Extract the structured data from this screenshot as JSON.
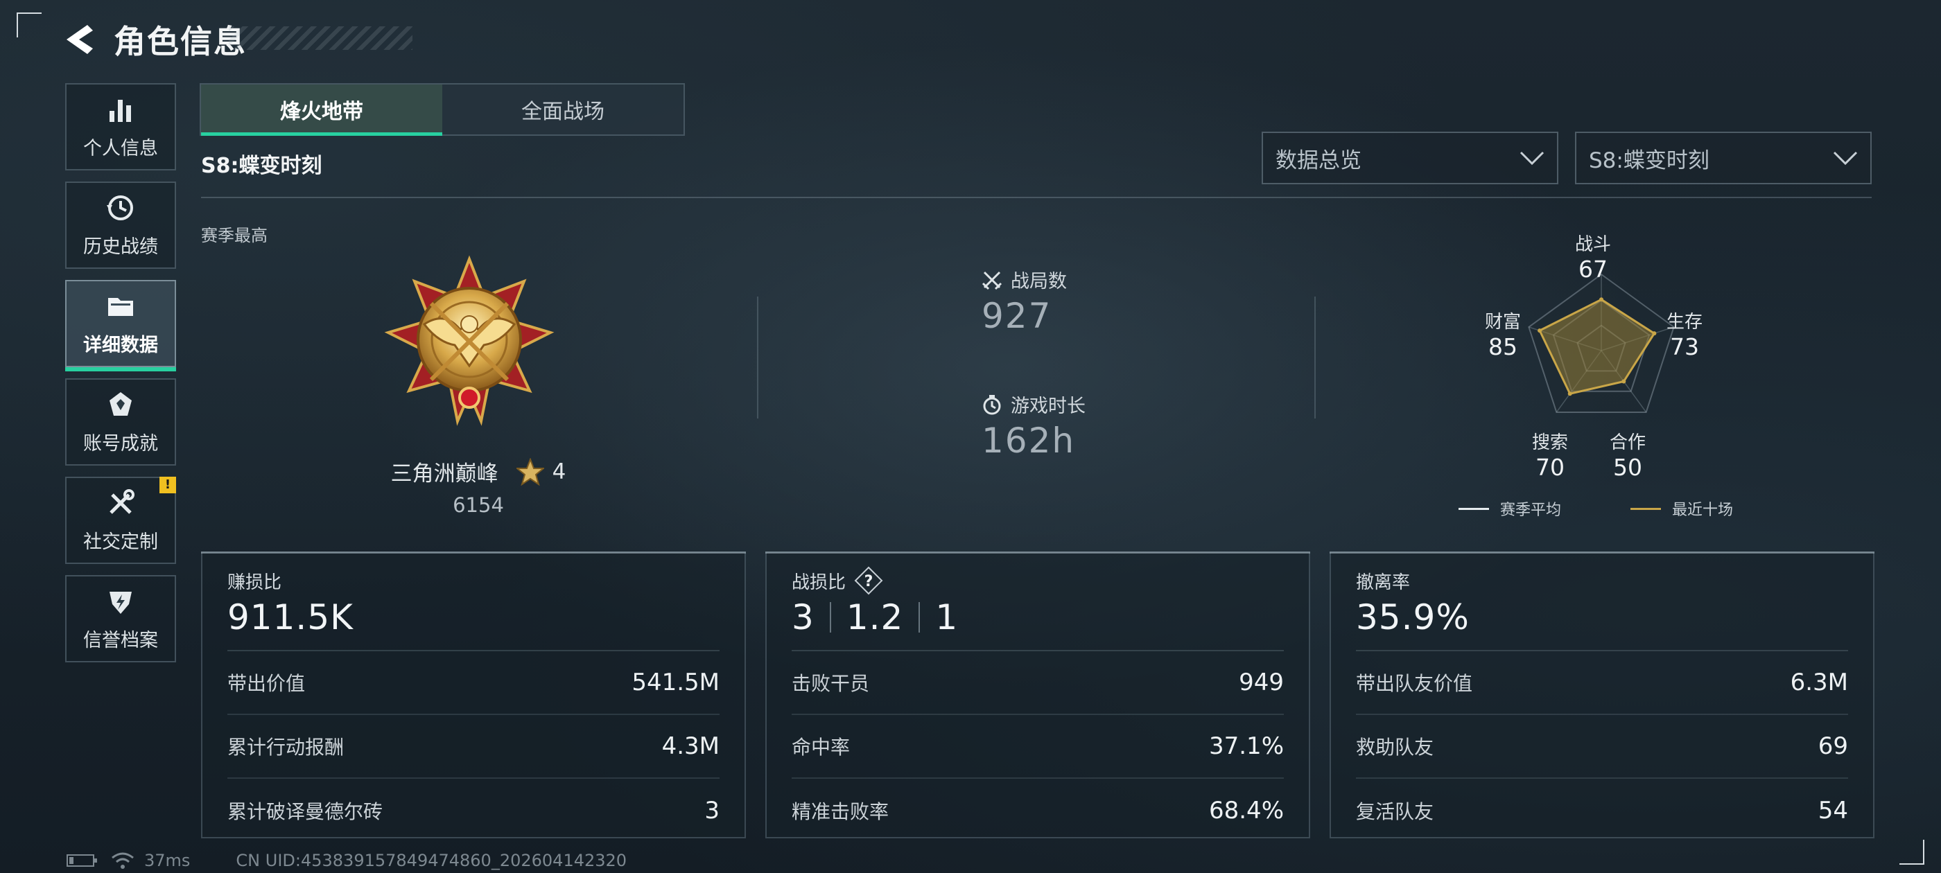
{
  "header": {
    "title": "角色信息"
  },
  "sidebar": {
    "items": [
      {
        "label": "个人信息",
        "icon": "bar-chart-icon",
        "active": false
      },
      {
        "label": "历史战绩",
        "icon": "history-icon",
        "active": false
      },
      {
        "label": "详细数据",
        "icon": "folder-icon",
        "active": true
      },
      {
        "label": "账号成就",
        "icon": "achievement-icon",
        "active": false
      },
      {
        "label": "社交定制",
        "icon": "tools-icon",
        "active": false,
        "badge": "!"
      },
      {
        "label": "信誉档案",
        "icon": "reputation-icon",
        "active": false
      }
    ]
  },
  "tabs": [
    {
      "label": "烽火地带",
      "active": true
    },
    {
      "label": "全面战场",
      "active": false
    }
  ],
  "season": {
    "label": "S8:蝶变时刻"
  },
  "filters": {
    "view": "数据总览",
    "season": "S8:蝶变时刻"
  },
  "rank": {
    "section_label": "赛季最高",
    "name": "三角洲巅峰",
    "stars": "4",
    "score": "6154"
  },
  "summary": {
    "matches_label": "战局数",
    "matches_value": "927",
    "playtime_label": "游戏时长",
    "playtime_value": "162h"
  },
  "radar": {
    "axes": [
      {
        "label": "战斗",
        "value": "67"
      },
      {
        "label": "生存",
        "value": "73"
      },
      {
        "label": "合作",
        "value": "50"
      },
      {
        "label": "搜索",
        "value": "70"
      },
      {
        "label": "财富",
        "value": "85"
      }
    ],
    "scores": [
      67,
      73,
      50,
      70,
      85
    ],
    "legend": {
      "season_avg": "赛季平均",
      "recent": "最近十场"
    },
    "colors": {
      "recent": "#c9a648",
      "season_avg": "#e6ecef"
    }
  },
  "cards": {
    "profit": {
      "title": "赚损比",
      "main": "911.5K",
      "rows": [
        {
          "label": "带出价值",
          "value": "541.5M"
        },
        {
          "label": "累计行动报酬",
          "value": "4.3M"
        },
        {
          "label": "累计破译曼德尔砖",
          "value": "3"
        }
      ]
    },
    "combat": {
      "title": "战损比",
      "kda": [
        "3",
        "1.2",
        "1"
      ],
      "rows": [
        {
          "label": "击败干员",
          "value": "949"
        },
        {
          "label": "命中率",
          "value": "37.1%"
        },
        {
          "label": "精准击败率",
          "value": "68.4%"
        }
      ]
    },
    "extract": {
      "title": "撤离率",
      "main": "35.9%",
      "rows": [
        {
          "label": "带出队友价值",
          "value": "6.3M"
        },
        {
          "label": "救助队友",
          "value": "69"
        },
        {
          "label": "复活队友",
          "value": "54"
        }
      ]
    }
  },
  "footer": {
    "ping": "37ms",
    "uid": "CN UID:453839157849474860_202604142320"
  },
  "colors": {
    "accent": "#28d0a0",
    "badge": "#f0c020"
  }
}
